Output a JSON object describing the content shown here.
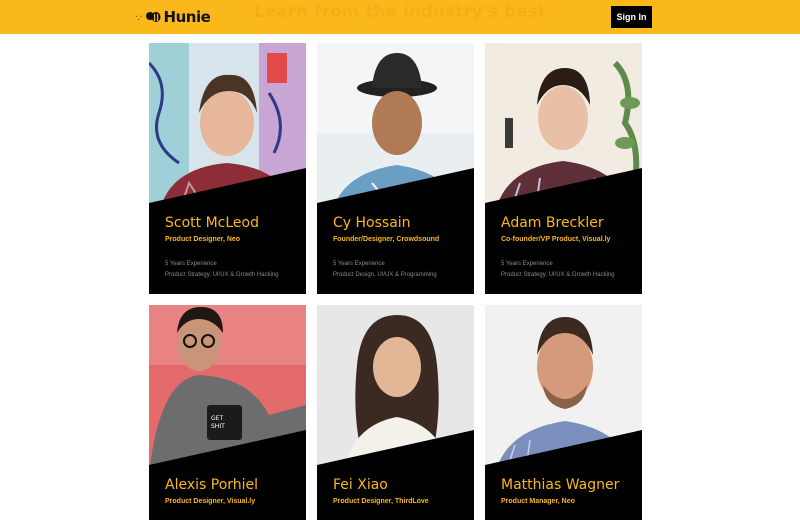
{
  "header": {
    "logo_text": "Hunie",
    "logo_dots": "·.·",
    "tagline": "Learn from the industry's best",
    "signin_label": "Sign In",
    "accent_color": "#fbb81b"
  },
  "mentors": [
    {
      "name": "Scott McLeod",
      "role": "Product Designer, Neo",
      "experience": "5 Years Experience",
      "skills": "Product Strategy, UI/UX & Growth Hacking"
    },
    {
      "name": "Cy Hossain",
      "role": "Founder/Designer, Crowdsound",
      "experience": "5 Years Experience",
      "skills": "Product Design, UI/UX & Programming"
    },
    {
      "name": "Adam Breckler",
      "role": "Co-founder/VP Product, Visual.ly",
      "experience": "5 Years Experience",
      "skills": "Product Strategy, UI/UX & Growth Hacking"
    },
    {
      "name": "Alexis Porhiel",
      "role": "Product Designer, Visual.ly"
    },
    {
      "name": "Fei Xiao",
      "role": "Product Designer, ThirdLove"
    },
    {
      "name": "Matthias Wagner",
      "role": "Product Manager, Neo"
    }
  ]
}
